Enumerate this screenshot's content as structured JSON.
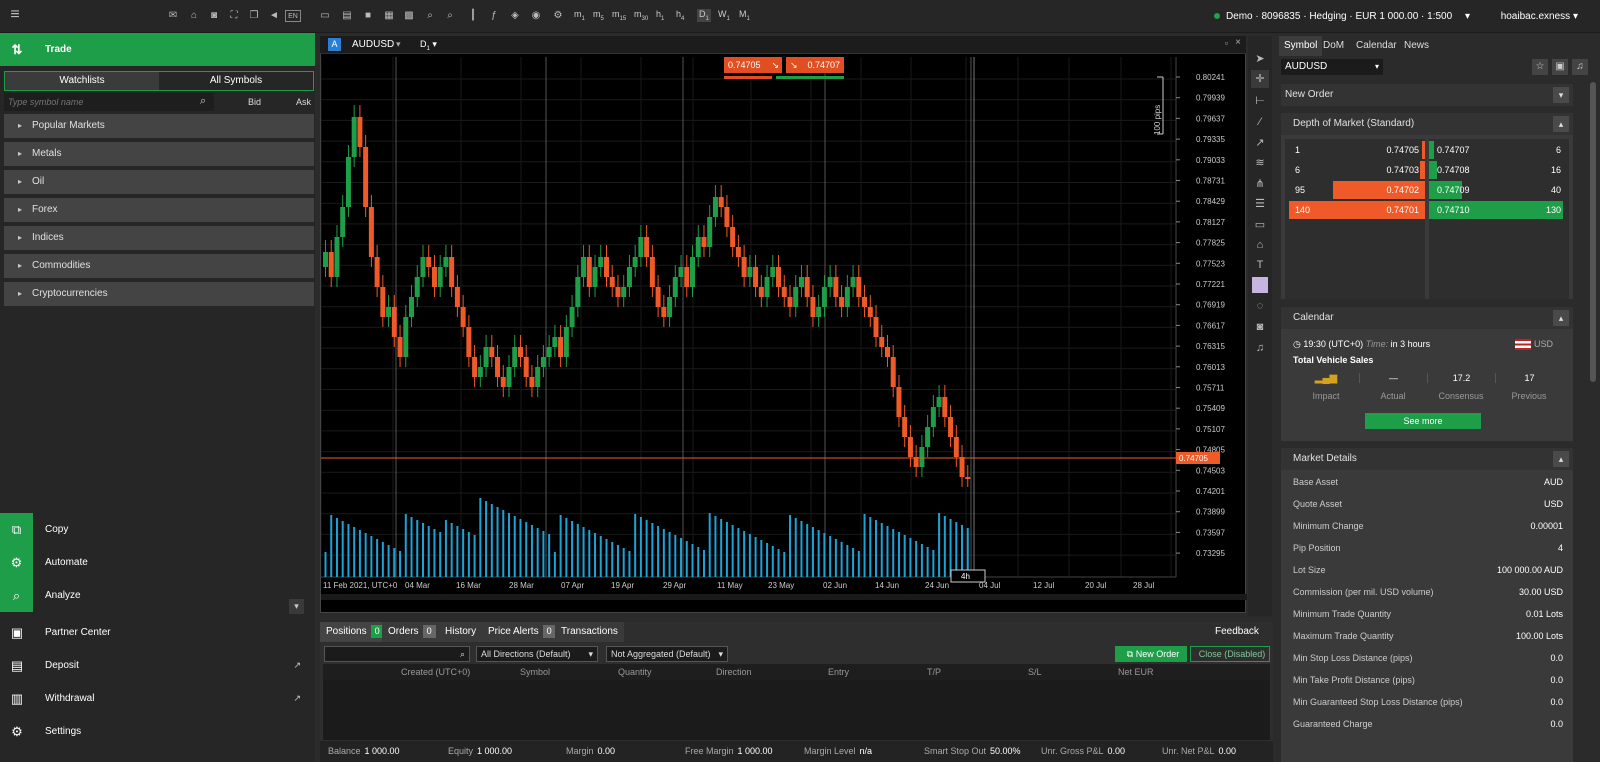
{
  "topbar": {
    "timeframes": [
      {
        "t": "m",
        "s": "1"
      },
      {
        "t": "m",
        "s": "5"
      },
      {
        "t": "m",
        "s": "15"
      },
      {
        "t": "m",
        "s": "30"
      },
      {
        "t": "h",
        "s": "1"
      },
      {
        "t": "h",
        "s": "4"
      },
      {
        "t": "D",
        "s": "1"
      },
      {
        "t": "W",
        "s": "1"
      },
      {
        "t": "M",
        "s": "1"
      }
    ],
    "lang": "EN",
    "account": "Demo · 8096835 · Hedging · EUR 1 000.00 · 1:500",
    "user": "hoaibac.exness"
  },
  "left": {
    "trade_label": "Trade",
    "tabs": [
      "Watchlists",
      "All Symbols"
    ],
    "search_placeholder": "Type symbol name",
    "bid": "Bid",
    "ask": "Ask",
    "categories": [
      "Popular Markets",
      "Metals",
      "Oil",
      "Forex",
      "Indices",
      "Commodities",
      "Cryptocurrencies"
    ],
    "nav": [
      "Copy",
      "Automate",
      "Analyze",
      "Partner Center",
      "Deposit",
      "Withdrawal",
      "Settings"
    ]
  },
  "chart": {
    "symbol": "AUDUSD",
    "timeframe": "D",
    "timeframe_sub": "1",
    "sell_price": "0.74705",
    "buy_price": "0.74707",
    "current_price": "0.74705",
    "pips_label": "100 pips",
    "crosshair_label": "4h",
    "price_labels": [
      "0.80241",
      "0.79939",
      "0.79637",
      "0.79335",
      "0.79033",
      "0.78731",
      "0.78429",
      "0.78127",
      "0.77825",
      "0.77523",
      "0.77221",
      "0.76919",
      "0.76617",
      "0.76315",
      "0.76013",
      "0.75711",
      "0.75409",
      "0.75107",
      "0.74805",
      "0.74503",
      "0.74201",
      "0.73899",
      "0.73597",
      "0.73295"
    ],
    "date_labels": [
      "11 Feb 2021, UTC+0",
      "04 Mar",
      "16 Mar",
      "28 Mar",
      "07 Apr",
      "19 Apr",
      "29 Apr",
      "11 May",
      "23 May",
      "02 Jun",
      "14 Jun",
      "24 Jun",
      "04 Jul",
      "12 Jul",
      "20 Jul",
      "28 Jul"
    ]
  },
  "bottom": {
    "tabs": [
      {
        "label": "Positions",
        "count": "0"
      },
      {
        "label": "Orders",
        "count": "0"
      },
      {
        "label": "History"
      },
      {
        "label": "Price Alerts",
        "count": "0"
      },
      {
        "label": "Transactions"
      }
    ],
    "feedback": "Feedback",
    "directions": "All Directions (Default)",
    "aggregation": "Not Aggregated (Default)",
    "new_order": "New Order",
    "close": "Close (Disabled)",
    "columns": [
      "Created (UTC+0)",
      "Symbol",
      "Quantity",
      "Direction",
      "Entry",
      "T/P",
      "S/L",
      "Net EUR"
    ],
    "footer": [
      {
        "k": "Balance",
        "v": "1 000.00"
      },
      {
        "k": "Equity",
        "v": "1 000.00"
      },
      {
        "k": "Margin",
        "v": "0.00"
      },
      {
        "k": "Free Margin",
        "v": "1 000.00"
      },
      {
        "k": "Margin Level",
        "v": "n/a"
      },
      {
        "k": "Smart Stop Out",
        "v": "50.00%"
      },
      {
        "k": "Unr. Gross P&L",
        "v": "0.00"
      },
      {
        "k": "Unr. Net P&L",
        "v": "0.00"
      }
    ]
  },
  "right": {
    "tabs": [
      "Symbol",
      "DoM",
      "Calendar",
      "News"
    ],
    "symbol": "AUDUSD",
    "new_order": "New Order",
    "dom_title": "Depth of Market (Standard)",
    "dom_bids": [
      {
        "vol": "1",
        "price": "0.74705"
      },
      {
        "vol": "6",
        "price": "0.74703"
      },
      {
        "vol": "95",
        "price": "0.74702"
      },
      {
        "vol": "140",
        "price": "0.74701"
      }
    ],
    "dom_asks": [
      {
        "price": "0.74707",
        "vol": "6"
      },
      {
        "price": "0.74708",
        "vol": "16"
      },
      {
        "price": "0.74709",
        "vol": "40"
      },
      {
        "price": "0.74710",
        "vol": "130"
      }
    ],
    "calendar_title": "Calendar",
    "cal_time": "19:30 (UTC+0)",
    "cal_time_lbl": "Time:",
    "cal_in": "in 3 hours",
    "cal_cur": "USD",
    "cal_event": "Total Vehicle Sales",
    "cal_cols": [
      {
        "v": "",
        "l": "Impact"
      },
      {
        "v": "—",
        "l": "Actual"
      },
      {
        "v": "17.2",
        "l": "Consensus"
      },
      {
        "v": "17",
        "l": "Previous"
      }
    ],
    "see_more": "See more",
    "md_title": "Market Details",
    "details": [
      {
        "k": "Base Asset",
        "v": "AUD"
      },
      {
        "k": "Quote Asset",
        "v": "USD"
      },
      {
        "k": "Minimum Change",
        "v": "0.00001"
      },
      {
        "k": "Pip Position",
        "v": "4"
      },
      {
        "k": "Lot Size",
        "v": "100 000.00 AUD"
      },
      {
        "k": "Commission (per mil. USD volume)",
        "v": "30.00 USD"
      },
      {
        "k": "Minimum Trade Quantity",
        "v": "0.01 Lots"
      },
      {
        "k": "Maximum Trade Quantity",
        "v": "100.00 Lots"
      },
      {
        "k": "Min Stop Loss Distance (pips)",
        "v": "0.0"
      },
      {
        "k": "Min Take Profit Distance (pips)",
        "v": "0.0"
      },
      {
        "k": "Min Guaranteed Stop Loss Distance (pips)",
        "v": "0.0"
      },
      {
        "k": "Guaranteed Charge",
        "v": "0.0"
      }
    ]
  },
  "colors": {
    "green": "#1f9e49",
    "red": "#f05a28",
    "volume": "#1aa3d9",
    "bg": "#000000"
  }
}
